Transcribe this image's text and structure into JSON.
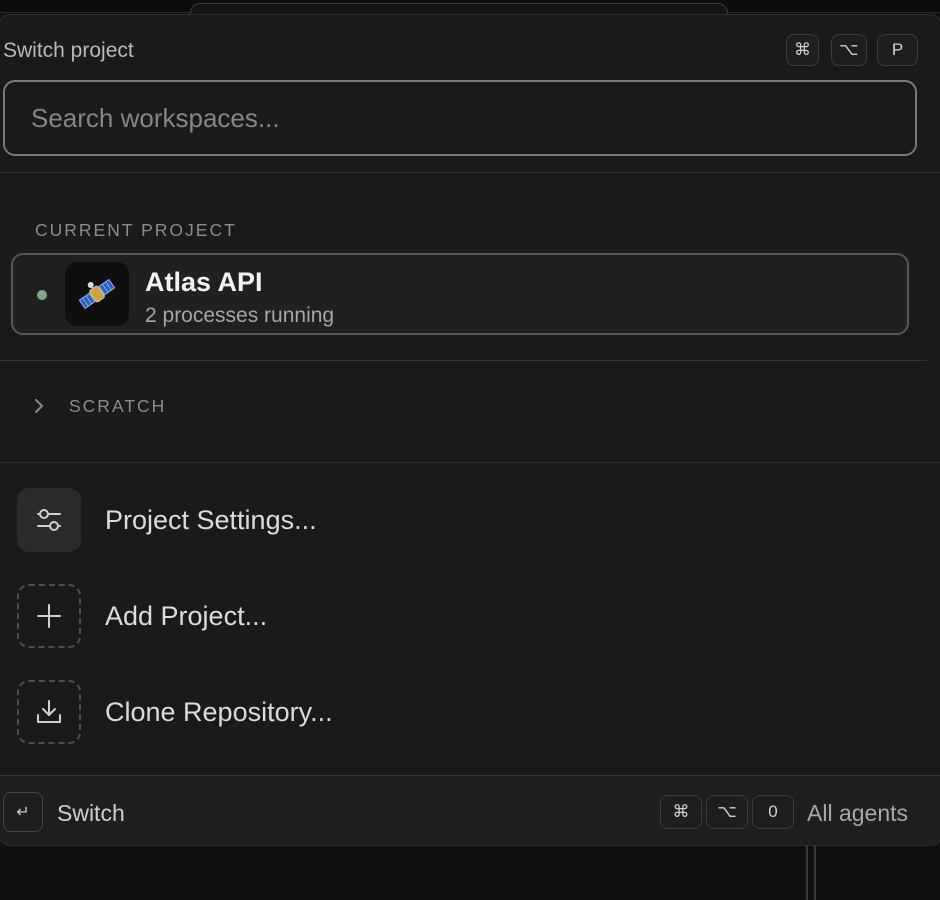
{
  "header": {
    "title": "Switch project",
    "shortcut": [
      "⌘",
      "⌥",
      "P"
    ]
  },
  "search": {
    "placeholder": "Search workspaces...",
    "value": ""
  },
  "current_project": {
    "section_label": "CURRENT PROJECT",
    "name": "Atlas API",
    "status": "2 processes running",
    "status_color": "#7fa889",
    "icon": "satellite-icon"
  },
  "scratch": {
    "label": "SCRATCH",
    "expanded": false
  },
  "actions": [
    {
      "label": "Project Settings...",
      "icon": "sliders-icon"
    },
    {
      "label": "Add Project...",
      "icon": "plus-icon"
    },
    {
      "label": "Clone Repository...",
      "icon": "download-icon"
    }
  ],
  "footer": {
    "enter_key": "↵",
    "switch_label": "Switch",
    "all_agents_shortcut": [
      "⌘",
      "⌥",
      "0"
    ],
    "all_agents_label": "All agents"
  }
}
